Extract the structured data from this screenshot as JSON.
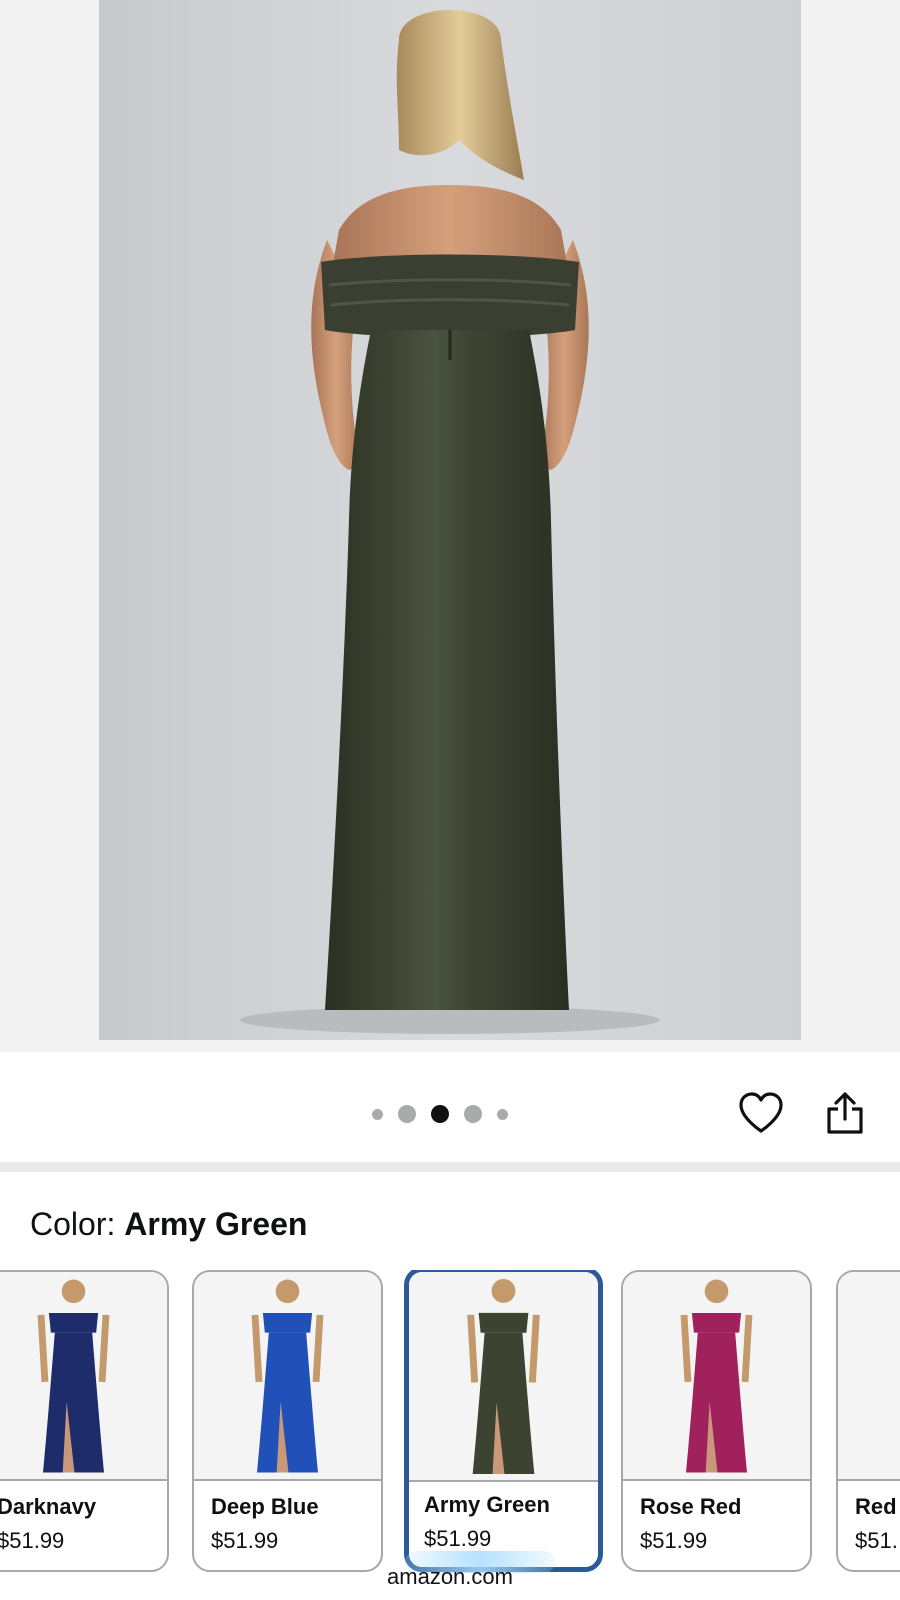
{
  "hero": {
    "image_desc_icon": "product-photo-back-view",
    "carousel": {
      "count": 5,
      "active_index": 2
    }
  },
  "actions": {
    "wishlist_icon": "heart-icon",
    "share_icon": "share-icon"
  },
  "color_selector": {
    "label": "Color:",
    "selected": "Army Green",
    "options": [
      {
        "name": "Darknavy",
        "price": "$51.99",
        "color": "#1f2c6b"
      },
      {
        "name": "Deep Blue",
        "price": "$51.99",
        "color": "#2150b8"
      },
      {
        "name": "Army Green",
        "price": "$51.99",
        "color": "#3c4330"
      },
      {
        "name": "Rose Red",
        "price": "$51.99",
        "color": "#a1215c"
      },
      {
        "name": "Red",
        "price": "$51.",
        "color": "#a01822"
      }
    ]
  },
  "browser": {
    "url": "amazon.com"
  },
  "colors": {
    "accent_selected_border": "#2a5a97",
    "dress_main": "#3b4130"
  }
}
